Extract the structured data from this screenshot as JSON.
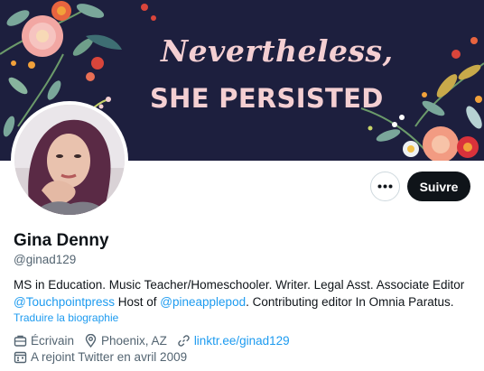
{
  "banner": {
    "line1": "Nevertheless,",
    "line2": "SHE PERSISTED"
  },
  "profile": {
    "name": "Gina Denny",
    "handle": "@ginad129",
    "bio": {
      "part1": "MS in Education. Music Teacher/Homeschooler. Writer. Legal Asst. Associate Editor ",
      "mention1": "@Touchpointpress",
      "part2": " Host of ",
      "mention2": "@pineapplepod",
      "part3": ". Contributing editor In Omnia Paratus."
    },
    "translate_label": "Traduire la biographie",
    "profession": "Écrivain",
    "location": "Phoenix, AZ",
    "website": "linktr.ee/ginad129",
    "joined": "A rejoint Twitter en avril 2009"
  },
  "actions": {
    "follow_label": "Suivre",
    "more_icon": "more-horizontal-icon"
  },
  "colors": {
    "link": "#1d9bf0",
    "secondary_text": "#536471",
    "follow_bg": "#0f1419",
    "banner_bg": "#1d1f3e",
    "banner_text": "#f4cfd2"
  }
}
